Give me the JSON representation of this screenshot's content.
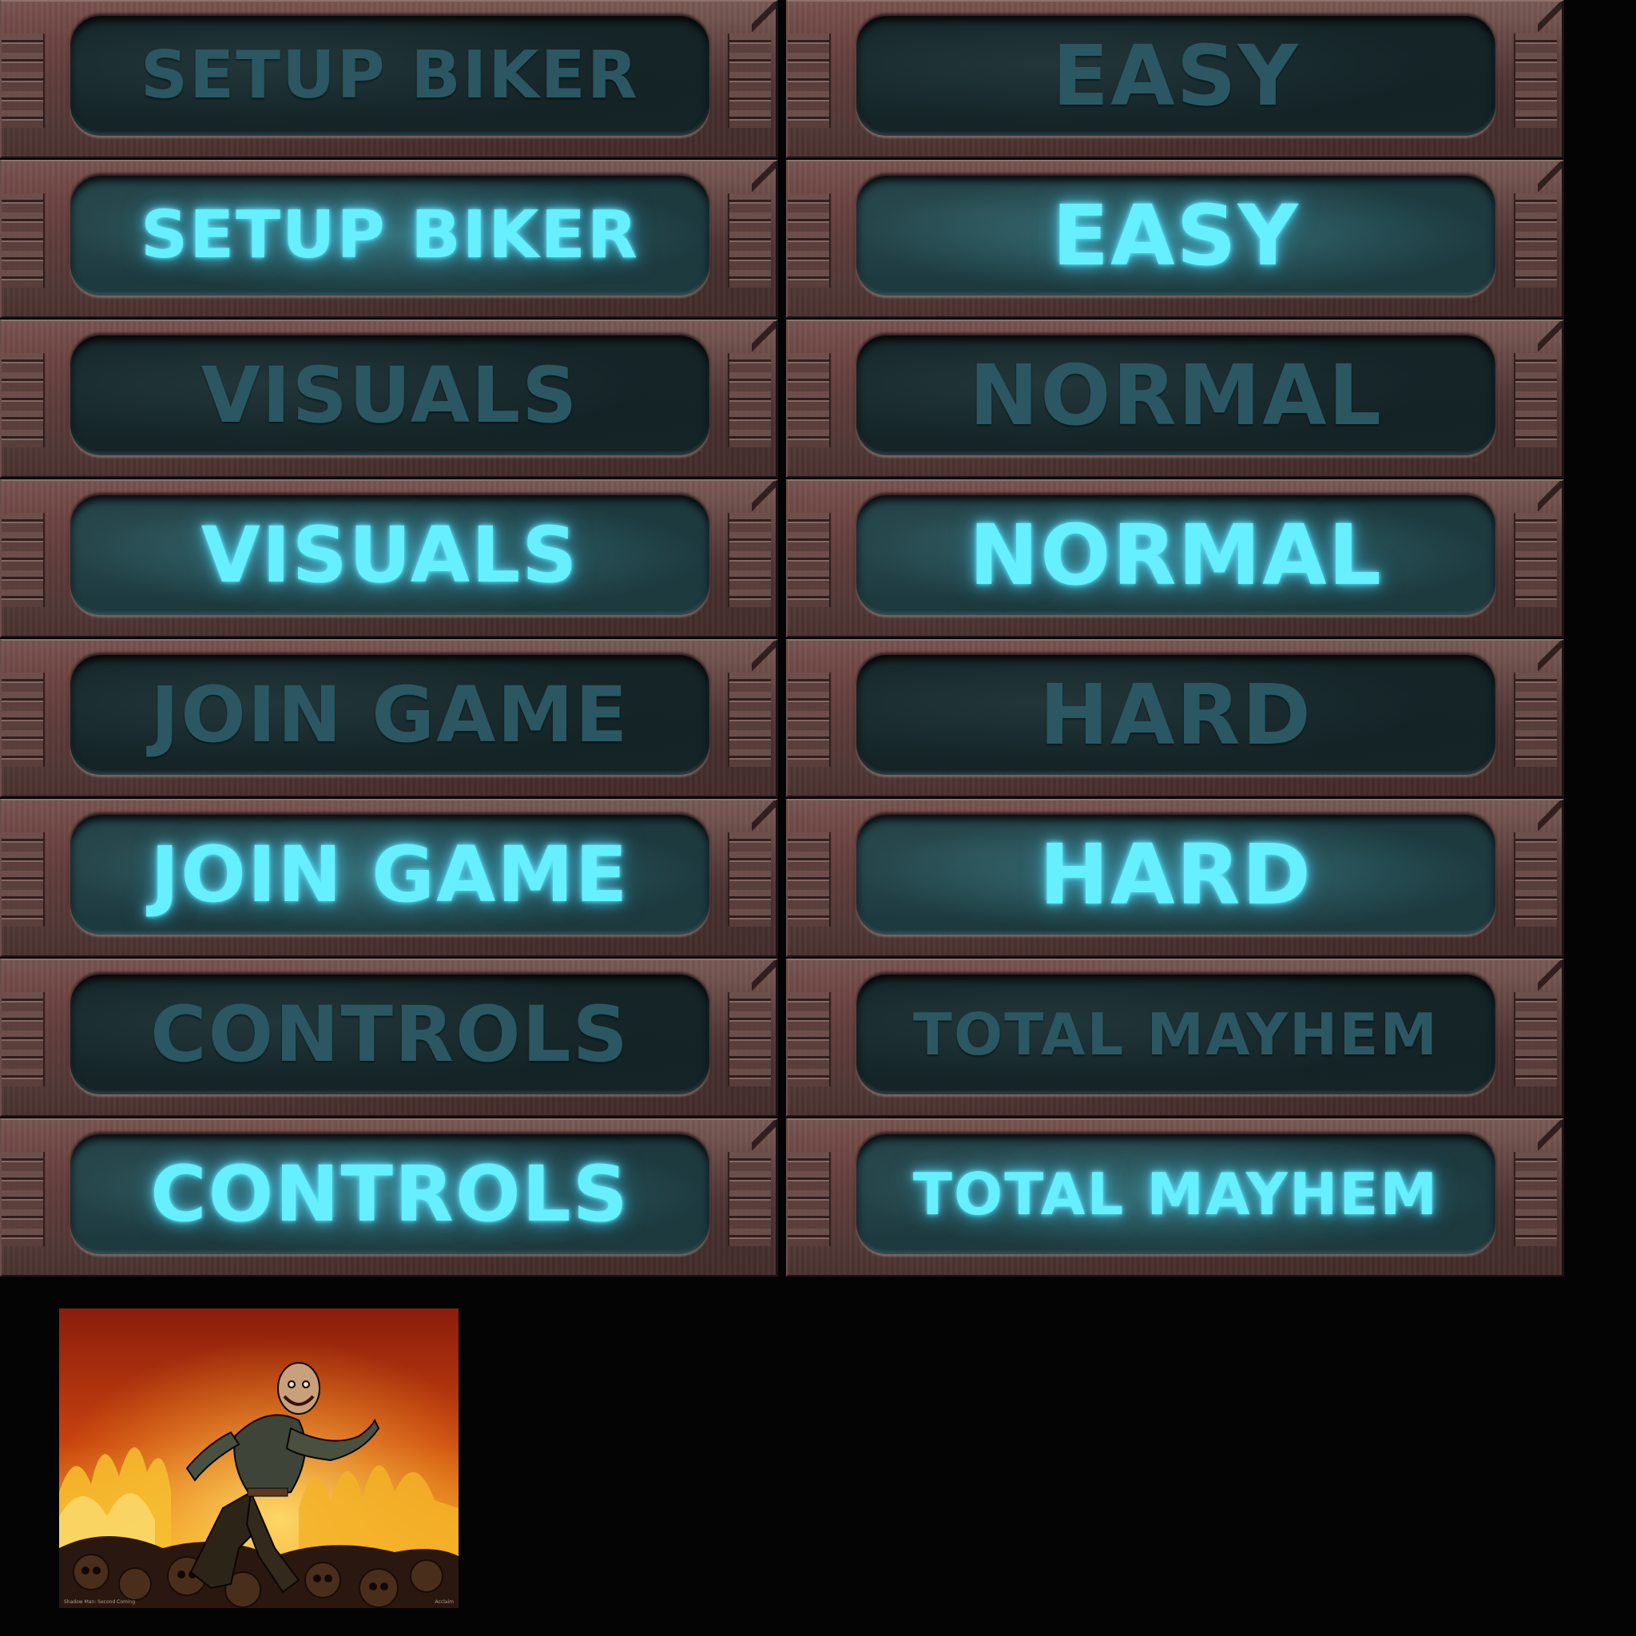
{
  "left_menu": [
    {
      "label": "SETUP BIKER",
      "state": "normal"
    },
    {
      "label": "SETUP BIKER",
      "state": "highlighted"
    },
    {
      "label": "VISUALS",
      "state": "normal"
    },
    {
      "label": "VISUALS",
      "state": "highlighted"
    },
    {
      "label": "JOIN GAME",
      "state": "normal"
    },
    {
      "label": "JOIN GAME",
      "state": "highlighted"
    },
    {
      "label": "CONTROLS",
      "state": "normal"
    },
    {
      "label": "CONTROLS",
      "state": "highlighted"
    }
  ],
  "right_menu": [
    {
      "label": "EASY",
      "state": "normal"
    },
    {
      "label": "EASY",
      "state": "highlighted"
    },
    {
      "label": "NORMAL",
      "state": "normal"
    },
    {
      "label": "NORMAL",
      "state": "highlighted"
    },
    {
      "label": "HARD",
      "state": "normal"
    },
    {
      "label": "HARD",
      "state": "highlighted"
    },
    {
      "label": "TOTAL MAYHEM",
      "state": "normal"
    },
    {
      "label": "TOTAL MAYHEM",
      "state": "highlighted"
    }
  ],
  "artwork": {
    "caption_left": "Shadow Man: Second Coming",
    "caption_right": "Acclaim"
  },
  "colors": {
    "label_normal": "#2b5762",
    "label_highlight": "#66f0ff",
    "plate": "#5e4240",
    "background": "#050404"
  },
  "icons": [
    "ridge-icon"
  ]
}
